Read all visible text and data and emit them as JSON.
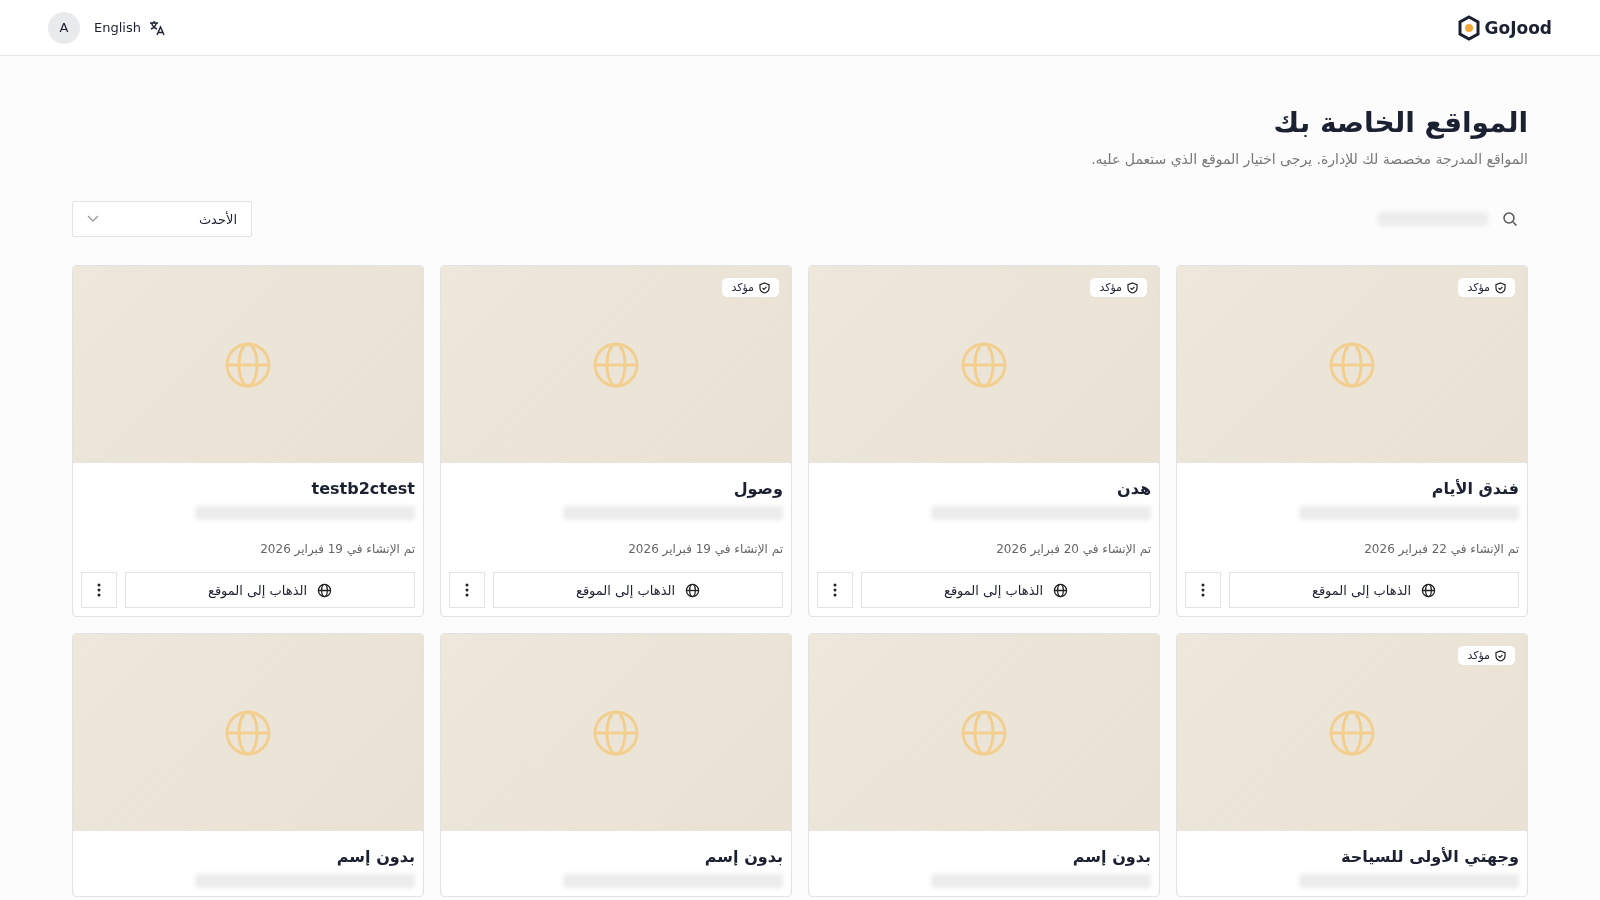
{
  "header": {
    "logo": "GoJood",
    "avatar": "A",
    "language": "English"
  },
  "page": {
    "title": "المواقع الخاصة بك",
    "subtitle": "المواقع المدرجة مخصصة لك للإدارة. يرجى اختيار الموقع الذي ستعمل عليه."
  },
  "sort": {
    "value": "الأحدث"
  },
  "cards": [
    {
      "name": "فندق الأيام",
      "verified": true,
      "badge": "مؤكد",
      "created": "تم الإنشاء في 22 فبراير 2026",
      "button": "الذهاب إلى الموقع"
    },
    {
      "name": "هدن",
      "verified": true,
      "badge": "مؤكد",
      "created": "تم الإنشاء في 20 فبراير 2026",
      "button": "الذهاب إلى الموقع"
    },
    {
      "name": "وصول",
      "verified": true,
      "badge": "مؤكد",
      "created": "تم الإنشاء في 19 فبراير 2026",
      "button": "الذهاب إلى الموقع"
    },
    {
      "name": "testb2ctest",
      "verified": false,
      "created": "تم الإنشاء في 19 فبراير 2026",
      "button": "الذهاب إلى الموقع"
    },
    {
      "name": "وجهتي الأولى للسياحة",
      "verified": true,
      "badge": "مؤكد"
    },
    {
      "name": "بدون إسم",
      "verified": false
    },
    {
      "name": "بدون إسم",
      "verified": false
    },
    {
      "name": "بدون إسم",
      "verified": false
    }
  ]
}
